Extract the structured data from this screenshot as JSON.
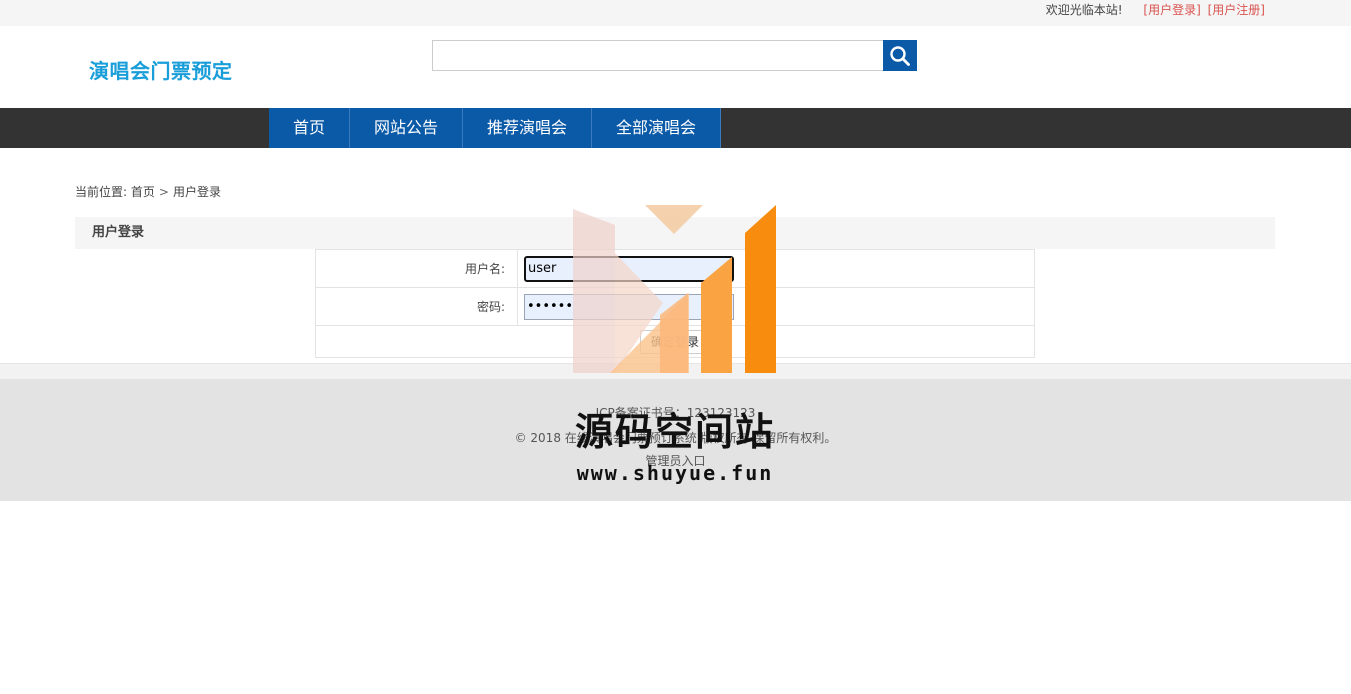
{
  "topbar": {
    "welcome": "欢迎光临本站!",
    "login_link": "[用户登录]",
    "register_link": "[用户注册]"
  },
  "header": {
    "site_title": "演唱会门票预定",
    "search": {
      "value": "",
      "placeholder": ""
    }
  },
  "nav": {
    "items": [
      {
        "label": "首页"
      },
      {
        "label": "网站公告"
      },
      {
        "label": "推荐演唱会"
      },
      {
        "label": "全部演唱会"
      }
    ]
  },
  "breadcrumb": {
    "prefix": "当前位置:",
    "home": "首页",
    "separator": ">",
    "current": "用户登录"
  },
  "login": {
    "title": "用户登录",
    "username_label": "用户名:",
    "username_value": "user",
    "password_label": "密码:",
    "password_value": "••••••",
    "submit_label": "确定登录"
  },
  "footer": {
    "icp": "ICP备案证书号：123123123",
    "copyright": "© 2018 在线演唱会门票预订系统 版权所有 保留所有权利。",
    "admin_link": "管理员入口"
  },
  "watermark": {
    "name": "源码空间站",
    "url": "www.shuyue.fun"
  },
  "colors": {
    "brand_title": "#1a9ed9",
    "nav_active": "#0a5aa8",
    "nav_bar": "#333333",
    "link_red": "#d9534f"
  }
}
